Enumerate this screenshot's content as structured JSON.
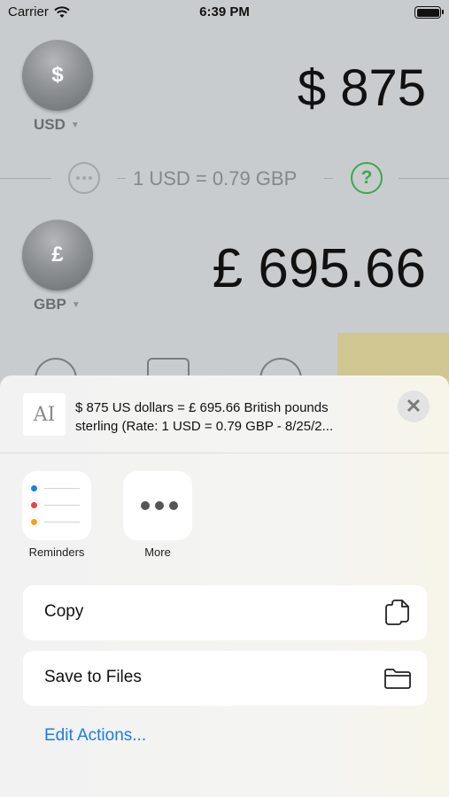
{
  "status_bar": {
    "carrier": "Carrier",
    "time": "6:39 PM"
  },
  "converter": {
    "from": {
      "symbol": "$",
      "code": "USD",
      "amount": "$ 875"
    },
    "rate_text": "1 USD = 0.79 GBP",
    "help_symbol": "?",
    "to": {
      "symbol": "£",
      "code": "GBP",
      "amount": "£ 695.66"
    },
    "caret": "▼"
  },
  "share_sheet": {
    "preview_text": "$ 875 US dollars = £ 695.66 British pounds sterling (Rate: 1 USD = 0.79 GBP - 8/25/2...",
    "doc_icon_glyph": "AI",
    "close_glyph": "✕",
    "apps": [
      {
        "label": "Reminders",
        "icon": "reminders-icon"
      },
      {
        "label": "More",
        "icon": "more-icon"
      }
    ],
    "reminder_colors": [
      "#1f7ee6",
      "#e8433e",
      "#f3a21a"
    ],
    "actions": [
      {
        "label": "Copy",
        "icon": "copy-icon"
      },
      {
        "label": "Save to Files",
        "icon": "folder-icon"
      }
    ],
    "edit_actions": "Edit Actions..."
  },
  "colors": {
    "accent_green": "#3aa84e",
    "link_blue": "#1a7ce8",
    "keypad_accent": "#cfc692"
  }
}
